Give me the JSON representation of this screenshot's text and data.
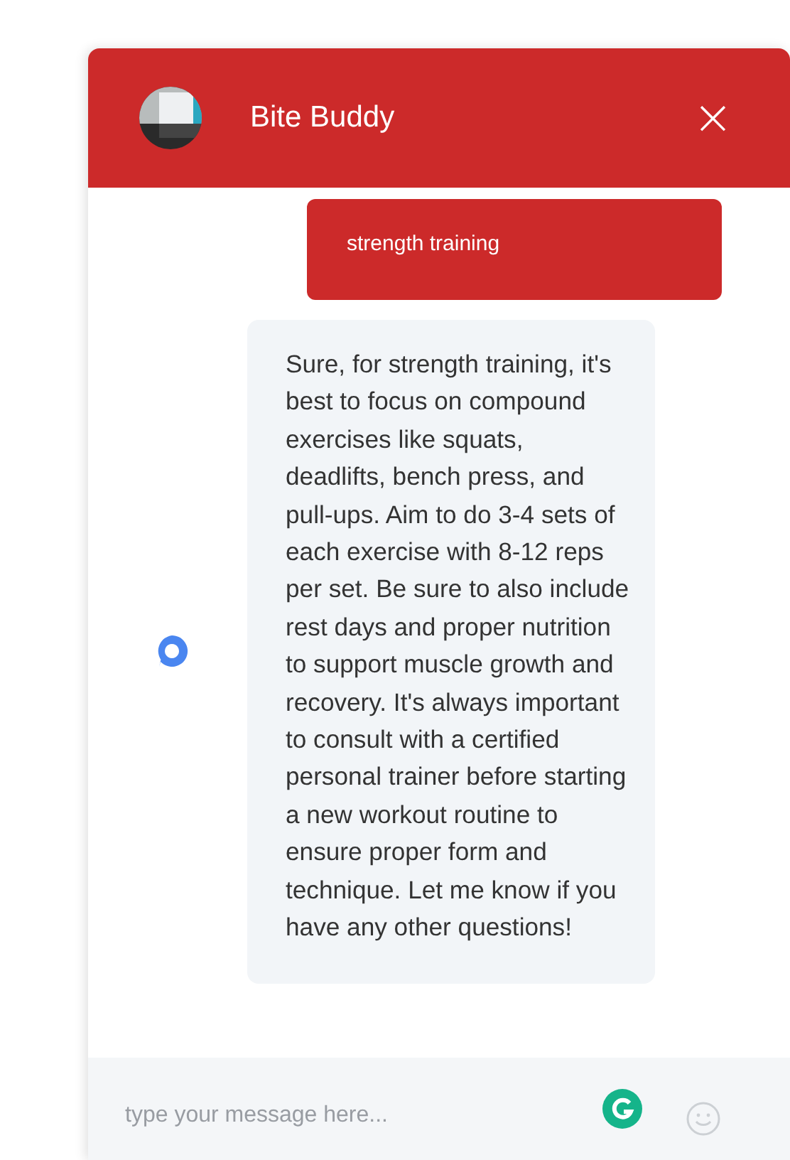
{
  "header": {
    "title": "Bite Buddy",
    "close": "×"
  },
  "messages": [
    {
      "kind": "user",
      "text": "strength training"
    },
    {
      "kind": "bot",
      "text": "Sure, for strength training, it's best to focus on compound exercises like squats, deadlifts, bench press, and pull-ups. Aim to do 3-4 sets of each exercise with 8-12 reps per set. Be sure to also include rest days and proper nutrition to support muscle growth and recovery. It's always important to consult with a certified personal trainer before starting a new workout routine to ensure proper form and technique. Let me know if you have any other questions!"
    }
  ],
  "composer": {
    "placeholder": "type your message here..."
  }
}
